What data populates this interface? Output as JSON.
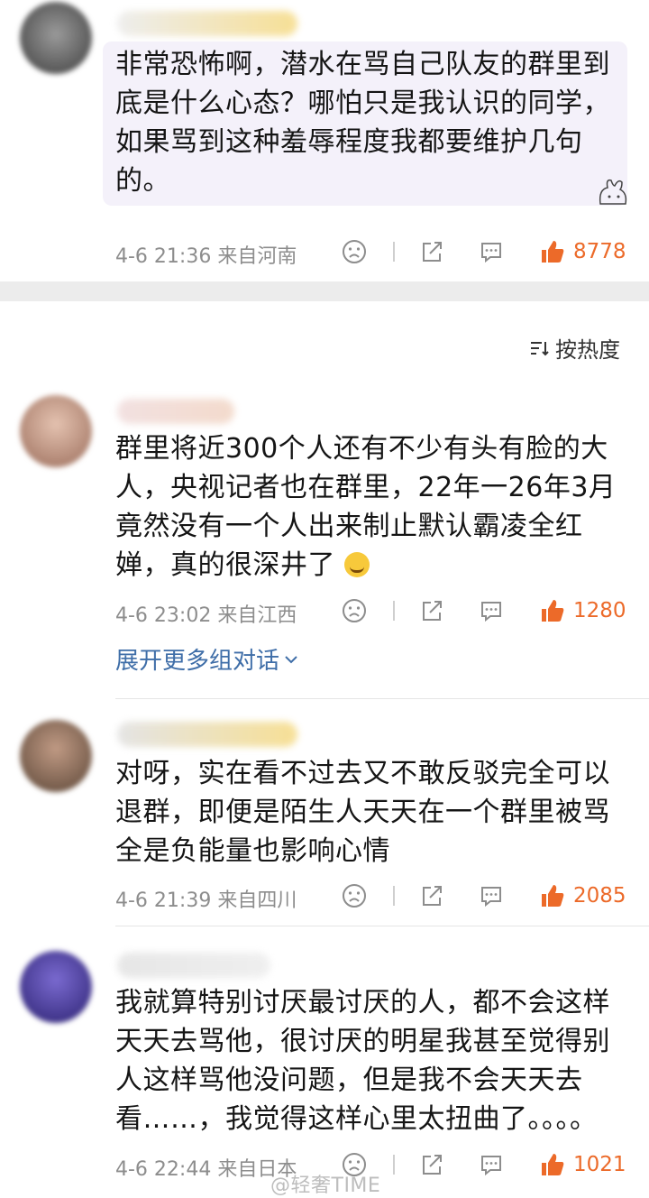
{
  "comments": [
    {
      "text": "非常恐怖啊，潜水在骂自己队友的群里到底是什么心态？哪怕只是我认识的同学，如果骂到这种羞辱程度我都要维护几句的。",
      "date": "4-6 21:36",
      "location": "来自河南",
      "likes": "8778",
      "avatar_color": "#6f6f6f"
    },
    {
      "text": "群里将近300个人还有不少有头有脸的大人，央视记者也在群里，22年一26年3月竟然没有一个人出来制止默认霸凌全红婵，真的很深井了",
      "date": "4-6 23:02",
      "location": "来自江西",
      "likes": "1280",
      "avatar_color": "#c79a86",
      "expand_label": "展开更多组对话"
    },
    {
      "text": "对呀，实在看不过去又不敢反驳完全可以退群，即便是陌生人天天在一个群里被骂全是负能量也影响心情",
      "date": "4-6 21:39",
      "location": "来自四川",
      "likes": "2085",
      "avatar_color": "#8a6c5a"
    },
    {
      "text": "我就算特别讨厌最讨厌的人，都不会这样天天去骂他，很讨厌的明星我甚至觉得别人这样骂他没问题，但是我不会天天去看……，我觉得这样心里太扭曲了。。。。",
      "date": "4-6 22:44",
      "location": "来自日本",
      "likes": "1021",
      "avatar_color": "#4b3d9c"
    }
  ],
  "sort_label": "按热度",
  "watermark": "@轻奢TIME",
  "colors": {
    "accent": "#ec6a29",
    "link": "#3f6ea8"
  },
  "icons": [
    "dislike-face-icon",
    "share-icon",
    "comment-icon",
    "thumbs-up-icon",
    "sort-icon",
    "chevron-down-icon"
  ]
}
